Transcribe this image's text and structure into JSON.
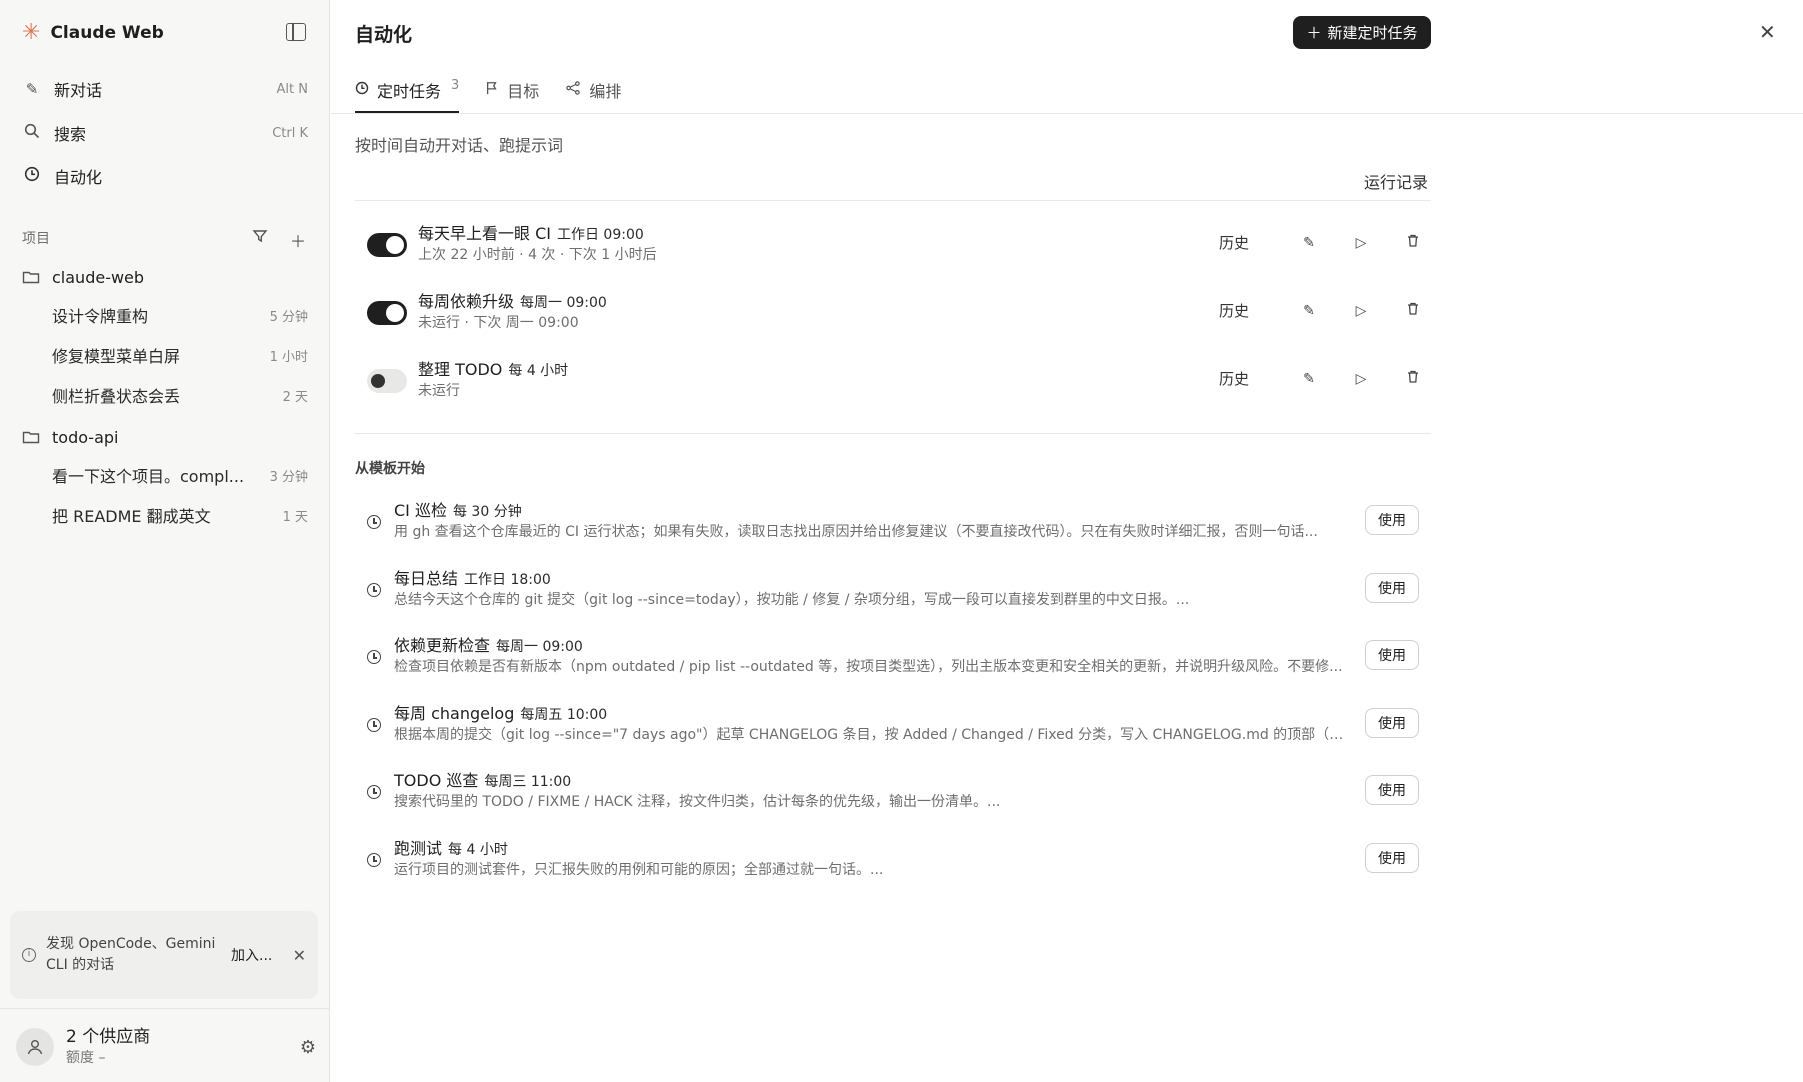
{
  "sidebar": {
    "brand": "Claude Web",
    "nav": [
      {
        "label": "新对话",
        "shortcut": "Alt N",
        "icon": "pencil-icon"
      },
      {
        "label": "搜索",
        "shortcut": "Ctrl K",
        "icon": "search-icon"
      },
      {
        "label": "自动化",
        "shortcut": "",
        "icon": "clock-icon"
      }
    ],
    "projects_label": "项目",
    "projects": [
      {
        "name": "claude-web",
        "conversations": [
          {
            "title": "设计令牌重构",
            "time": "5 分钟"
          },
          {
            "title": "修复模型菜单白屏",
            "time": "1 小时"
          },
          {
            "title": "侧栏折叠状态会丢",
            "time": "2 天"
          }
        ]
      },
      {
        "name": "todo-api",
        "conversations": [
          {
            "title": "看一下这个项目。compl...",
            "time": "3 分钟"
          },
          {
            "title": "把 README 翻成英文",
            "time": "1 天"
          }
        ]
      }
    ],
    "notice": {
      "text": "发现 OpenCode、Gemini CLI 的对话",
      "action": "加入..."
    },
    "user": {
      "main": "2 个供应商",
      "sub": "额度 –"
    }
  },
  "main": {
    "title": "自动化",
    "new_task_label": "新建定时任务",
    "tabs": [
      {
        "label": "定时任务",
        "count": "3"
      },
      {
        "label": "目标",
        "count": ""
      },
      {
        "label": "编排",
        "count": ""
      }
    ],
    "subtitle": "按时间自动开对话、跑提示词",
    "run_log": "运行记录",
    "history_label": "历史",
    "tasks": [
      {
        "name": "每天早上看一眼 CI",
        "schedule": "工作日 09:00",
        "meta": "上次 22 小时前 · 4 次 · 下次 1 小时后",
        "enabled": true
      },
      {
        "name": "每周依赖升级",
        "schedule": "每周一 09:00",
        "meta": "未运行 · 下次 周一 09:00",
        "enabled": true
      },
      {
        "name": "整理 TODO",
        "schedule": "每 4 小时",
        "meta": "未运行",
        "enabled": false
      }
    ],
    "templates_header": "从模板开始",
    "use_label": "使用",
    "templates": [
      {
        "name": "CI 巡检",
        "schedule": "每 30 分钟",
        "desc": "用 gh 查看这个仓库最近的 CI 运行状态；如果有失败，读取日志找出原因并给出修复建议（不要直接改代码）。只在有失败时详细汇报，否则一句话..."
      },
      {
        "name": "每日总结",
        "schedule": "工作日 18:00",
        "desc": "总结今天这个仓库的 git 提交（git log --since=today），按功能 / 修复 / 杂项分组，写成一段可以直接发到群里的中文日报。..."
      },
      {
        "name": "依赖更新检查",
        "schedule": "每周一 09:00",
        "desc": "检查项目依赖是否有新版本（npm outdated / pip list --outdated 等，按项目类型选），列出主版本变更和安全相关的更新，并说明升级风险。不要修..."
      },
      {
        "name": "每周 changelog",
        "schedule": "每周五 10:00",
        "desc": "根据本周的提交（git log --since=\"7 days ago\"）起草 CHANGELOG 条目，按 Added / Changed / Fixed 分类，写入 CHANGELOG.md 的顶部（如果没..."
      },
      {
        "name": "TODO 巡查",
        "schedule": "每周三 11:00",
        "desc": "搜索代码里的 TODO / FIXME / HACK 注释，按文件归类，估计每条的优先级，输出一份清单。..."
      },
      {
        "name": "跑测试",
        "schedule": "每 4 小时",
        "desc": "运行项目的测试套件，只汇报失败的用例和可能的原因；全部通过就一句话。..."
      }
    ]
  }
}
